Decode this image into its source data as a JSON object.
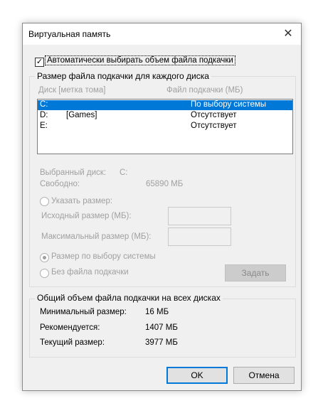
{
  "window": {
    "title": "Виртуальная память",
    "close_label": "✕"
  },
  "auto_manage": {
    "label": "Автоматически выбирать объем файла подкачки",
    "checked": true,
    "mark": "✓"
  },
  "per_drive": {
    "caption": "Размер файла подкачки для каждого диска",
    "col_drive": "Диск [метка тома]",
    "col_pagefile": "Файл подкачки (МБ)",
    "drives": [
      {
        "letter": "C:",
        "label": "",
        "pagefile": "По выбору системы",
        "selected": true
      },
      {
        "letter": "D:",
        "label": "[Games]",
        "pagefile": "Отсутствует",
        "selected": false
      },
      {
        "letter": "E:",
        "label": "",
        "pagefile": "Отсутствует",
        "selected": false
      }
    ],
    "selected_drive_label": "Выбранный диск:",
    "selected_drive_value": "C:",
    "free_label": "Свободно:",
    "free_value": "65890 МБ",
    "custom_size_label": "Указать размер:",
    "initial_size_label": "Исходный размер (МБ):",
    "max_size_label": "Максимальный размер (МБ):",
    "system_managed_label": "Размер по выбору системы",
    "no_pagefile_label": "Без файла подкачки",
    "set_button": "Задать"
  },
  "totals": {
    "caption": "Общий объем файла подкачки на всех дисках",
    "min_label": "Минимальный размер:",
    "min_value": "16 МБ",
    "recommended_label": "Рекомендуется:",
    "recommended_value": "1407 МБ",
    "current_label": "Текущий размер:",
    "current_value": "3977 МБ"
  },
  "buttons": {
    "ok": "OK",
    "cancel": "Отмена"
  }
}
